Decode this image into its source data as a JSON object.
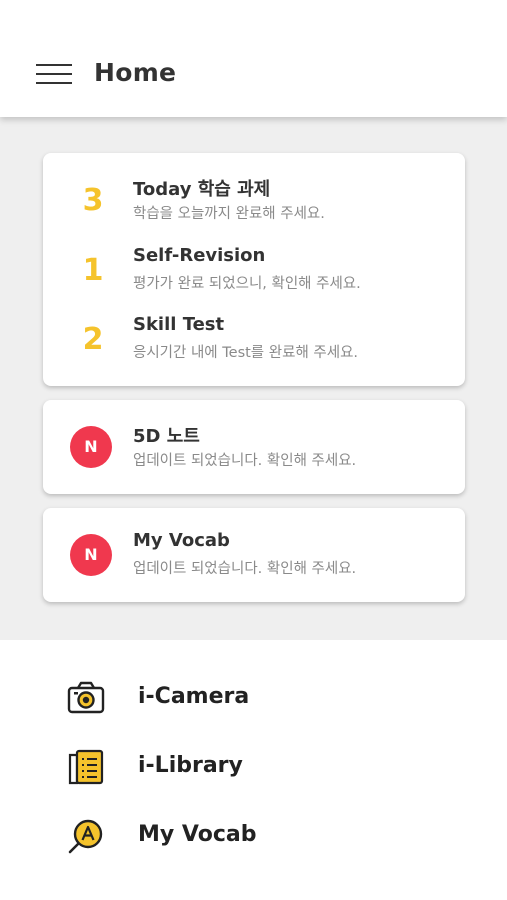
{
  "header": {
    "title": "Home",
    "menu_icon": "hamburger-menu-icon"
  },
  "task_card": {
    "items": [
      {
        "count": "3",
        "title": "Today 학습 과제",
        "subtitle": "학습을 오늘까지 완료해 주세요."
      },
      {
        "count": "1",
        "title": "Self-Revision",
        "subtitle": "평가가 완료 되었으니, 확인해 주세요."
      },
      {
        "count": "2",
        "title": "Skill Test",
        "subtitle": "응시기간 내에 Test를 완료해 주세요."
      }
    ],
    "count_color": "#f5c32c"
  },
  "notifications": [
    {
      "badge": "N",
      "title": "5D 노트",
      "subtitle": "업데이트 되었습니다. 확인해 주세요."
    },
    {
      "badge": "N",
      "title": "My Vocab",
      "subtitle": "업데이트 되었습니다. 확인해 주세요."
    }
  ],
  "badge_color": "#f0384e",
  "bottom_menu": {
    "items": [
      {
        "label": "i-Camera",
        "icon": "camera-icon"
      },
      {
        "label": "i-Library",
        "icon": "book-list-icon"
      },
      {
        "label": "My Vocab",
        "icon": "vocab-search-icon"
      }
    ]
  }
}
